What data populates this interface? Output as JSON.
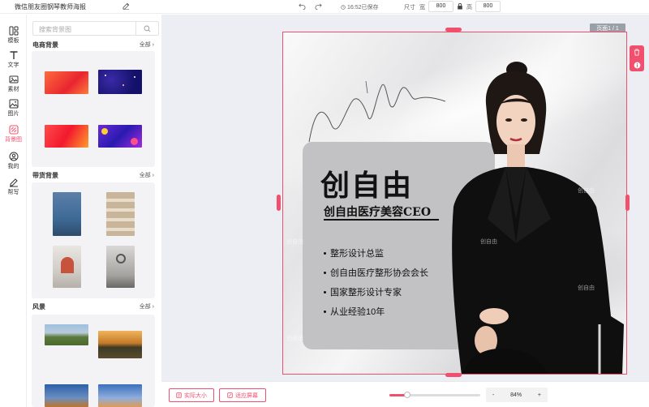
{
  "header": {
    "doc_title": "微信朋友圈钢琴教师海报",
    "save_status": "16:52已保存",
    "size_label": "尺寸",
    "width_label": "宽",
    "width_value": "800",
    "height_label": "高",
    "height_value": "800"
  },
  "rail": {
    "items": [
      {
        "label": "模板",
        "icon": "template-icon"
      },
      {
        "label": "文字",
        "icon": "text-icon"
      },
      {
        "label": "素材",
        "icon": "material-icon"
      },
      {
        "label": "图片",
        "icon": "image-icon"
      },
      {
        "label": "背景图",
        "icon": "background-icon",
        "active": true
      },
      {
        "label": "我的",
        "icon": "user-icon"
      },
      {
        "label": "帮写",
        "icon": "write-icon"
      }
    ]
  },
  "panel": {
    "search_placeholder": "搜索背景图",
    "sections": [
      {
        "title": "电商背景",
        "more": "全部"
      },
      {
        "title": "带货背景",
        "more": "全部"
      },
      {
        "title": "风景",
        "more": "全部"
      }
    ]
  },
  "canvas": {
    "page_badge": "页面1 / 1",
    "title": "创自由",
    "subtitle": "创自由医疗美容CEO",
    "bullets": [
      "整形设计总监",
      "创自由医疗整形协会会长",
      "国家整形设计专家",
      "从业经验10年"
    ],
    "watermark": "创自由"
  },
  "footer": {
    "actual_size": "实际大小",
    "fit_screen": "适应屏幕",
    "zoom_minus": "-",
    "zoom_value": "84%",
    "zoom_plus": "+",
    "zoom_fraction": 0.2
  },
  "colors": {
    "accent": "#f0506e"
  }
}
